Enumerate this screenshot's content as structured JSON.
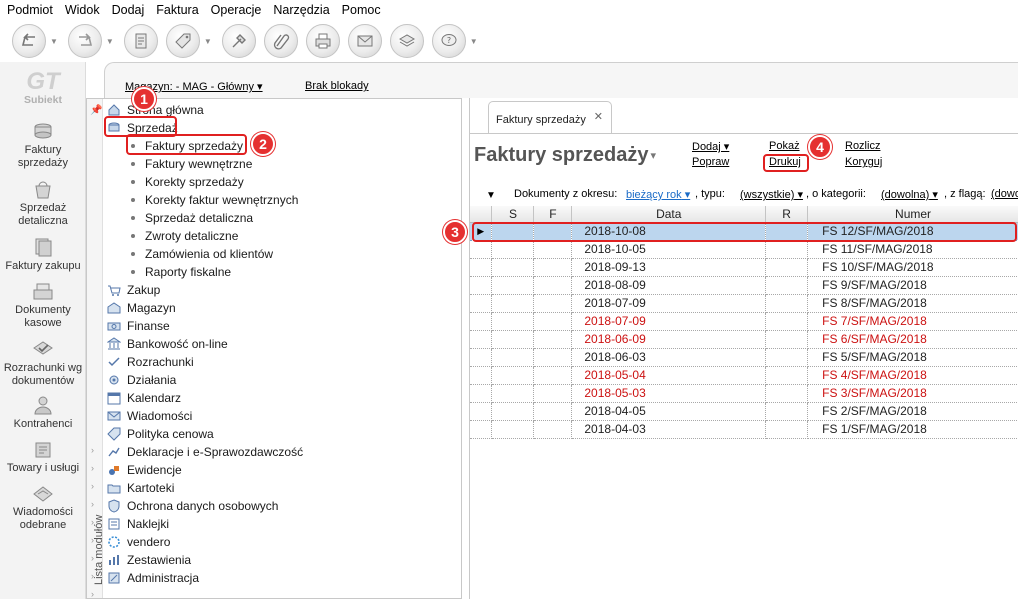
{
  "menu": [
    "Podmiot",
    "Widok",
    "Dodaj",
    "Faktura",
    "Operacje",
    "Narzędzia",
    "Pomoc"
  ],
  "toolbar": {
    "buttons": [
      "back-icon",
      "forward-icon",
      "document-icon",
      "tag-icon",
      "tool-icon",
      "clip-icon",
      "printer-icon",
      "envelope-icon",
      "stack-icon",
      "help-icon"
    ]
  },
  "app_logo": "Subiekt",
  "left_modules": [
    {
      "label": "Faktury sprzedaży",
      "icon": "coins-icon"
    },
    {
      "label": "Sprzedaż detaliczna",
      "icon": "bag-icon"
    },
    {
      "label": "Faktury zakupu",
      "icon": "invoices-icon"
    },
    {
      "label": "Dokumenty kasowe",
      "icon": "cash-register-icon"
    },
    {
      "label": "Rozrachunki wg dokumentów",
      "icon": "check-icon"
    },
    {
      "label": "Kontrahenci",
      "icon": "person-icon"
    },
    {
      "label": "Towary i usługi",
      "icon": "box-icon"
    },
    {
      "label": "Wiadomości odebrane",
      "icon": "mail-icon"
    }
  ],
  "status": {
    "magazyn": "Magazyn: - MAG - Główny ▾",
    "blokady": "Brak blokady"
  },
  "module_panel": {
    "side_label": "Lista modułów",
    "tree": [
      {
        "label": "Strona główna",
        "level": 0
      },
      {
        "label": "Sprzedaż",
        "level": 0
      },
      {
        "label": "Faktury sprzedaży",
        "level": 1
      },
      {
        "label": "Faktury wewnętrzne",
        "level": 1
      },
      {
        "label": "Korekty sprzedaży",
        "level": 1
      },
      {
        "label": "Korekty faktur wewnętrznych",
        "level": 1
      },
      {
        "label": "Sprzedaż detaliczna",
        "level": 1
      },
      {
        "label": "Zwroty detaliczne",
        "level": 1
      },
      {
        "label": "Zamówienia od klientów",
        "level": 1
      },
      {
        "label": "Raporty fiskalne",
        "level": 1
      },
      {
        "label": "Zakup",
        "level": 0
      },
      {
        "label": "Magazyn",
        "level": 0
      },
      {
        "label": "Finanse",
        "level": 0
      },
      {
        "label": "Bankowość on-line",
        "level": 0
      },
      {
        "label": "Rozrachunki",
        "level": 0
      },
      {
        "label": "Działania",
        "level": 0
      },
      {
        "label": "Kalendarz",
        "level": 0
      },
      {
        "label": "Wiadomości",
        "level": 0
      },
      {
        "label": "Polityka cenowa",
        "level": 0
      },
      {
        "label": "Deklaracje i e-Sprawozdawczość",
        "level": 0
      },
      {
        "label": "Ewidencje",
        "level": 0
      },
      {
        "label": "Kartoteki",
        "level": 0
      },
      {
        "label": "Ochrona danych osobowych",
        "level": 0
      },
      {
        "label": "Naklejki",
        "level": 0
      },
      {
        "label": "vendero",
        "level": 0
      },
      {
        "label": "Zestawienia",
        "level": 0
      },
      {
        "label": "Administracja",
        "level": 0
      }
    ]
  },
  "content": {
    "tab_label": "Faktury sprzedaży",
    "tab_close": "✕",
    "title": "Faktury sprzedaży",
    "actions": {
      "dodaj": "Dodaj ▾",
      "popraw": "Popraw",
      "pokaz": "Pokaż",
      "drukuj": "Drukuj",
      "rozlicz": "Rozlicz",
      "koryguj": "Koryguj"
    },
    "filters": {
      "period_label": "Dokumenty z okresu:",
      "period_value": "bieżący rok",
      "type_label": ", typu:",
      "type_value": "(wszystkie)",
      "category_label": ", o kategorii:",
      "category_value": "(dowolna)",
      "flag_label": ", z flagą:",
      "flag_value": "(dowo"
    },
    "columns": [
      "S",
      "F",
      "Data",
      "R",
      "Numer"
    ],
    "rows": [
      {
        "date": "2018-10-08",
        "number": "FS 12/SF/MAG/2018",
        "red": false,
        "selected": true
      },
      {
        "date": "2018-10-05",
        "number": "FS 11/SF/MAG/2018",
        "red": false,
        "selected": false
      },
      {
        "date": "2018-09-13",
        "number": "FS 10/SF/MAG/2018",
        "red": false,
        "selected": false
      },
      {
        "date": "2018-08-09",
        "number": "FS 9/SF/MAG/2018",
        "red": false,
        "selected": false
      },
      {
        "date": "2018-07-09",
        "number": "FS 8/SF/MAG/2018",
        "red": false,
        "selected": false
      },
      {
        "date": "2018-07-09",
        "number": "FS 7/SF/MAG/2018",
        "red": true,
        "selected": false
      },
      {
        "date": "2018-06-09",
        "number": "FS 6/SF/MAG/2018",
        "red": true,
        "selected": false
      },
      {
        "date": "2018-06-03",
        "number": "FS 5/SF/MAG/2018",
        "red": false,
        "selected": false
      },
      {
        "date": "2018-05-04",
        "number": "FS 4/SF/MAG/2018",
        "red": true,
        "selected": false
      },
      {
        "date": "2018-05-03",
        "number": "FS 3/SF/MAG/2018",
        "red": true,
        "selected": false
      },
      {
        "date": "2018-04-05",
        "number": "FS 2/SF/MAG/2018",
        "red": false,
        "selected": false
      },
      {
        "date": "2018-04-03",
        "number": "FS 1/SF/MAG/2018",
        "red": false,
        "selected": false
      }
    ]
  },
  "callouts": [
    "1",
    "2",
    "3",
    "4"
  ],
  "colors": {
    "callout_red": "#e53030",
    "link_blue": "#1a6bc7",
    "overdue_red": "#cc1111",
    "selected_row": "#bcd6ee"
  }
}
